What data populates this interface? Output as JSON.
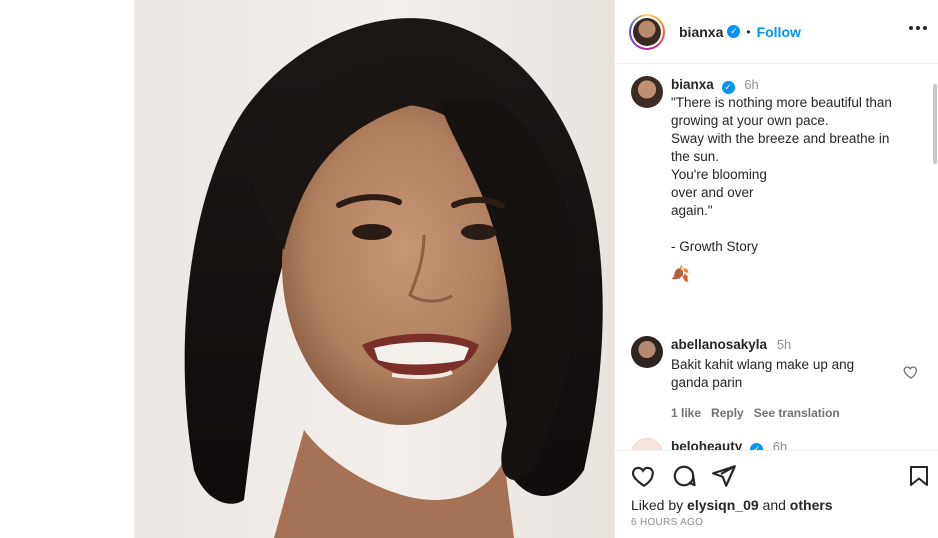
{
  "post": {
    "username": "bianxa",
    "follow_label": "Follow",
    "separator": "•",
    "photo_alt": "Smiling woman with shoulder-length black hair"
  },
  "caption": {
    "username": "bianxa",
    "time": "6h",
    "text": "\"There is nothing more beautiful than growing at your own pace.\nSway with the breeze and breathe in the sun.\nYou're blooming\nover and over\nagain.\"\n\n- Growth Story",
    "emoji": "🍂"
  },
  "comments": [
    {
      "username": "abellanosakyla",
      "time": "5h",
      "text": "Bakit kahit wlang make up ang ganda parin",
      "likes_label": "1 like",
      "reply_label": "Reply",
      "translate_label": "See translation"
    },
    {
      "username": "beloheauty",
      "time": "6h"
    }
  ],
  "footer": {
    "liked_prefix": "Liked by",
    "liked_user": "elysiqn_09",
    "and_label": "and",
    "others_label": "others",
    "timestamp": "6 HOURS AGO"
  },
  "icons": {
    "verified": "verified-badge-icon",
    "more": "more-options-icon",
    "like": "heart-icon",
    "comment": "comment-icon",
    "share": "share-icon",
    "save": "bookmark-icon"
  },
  "colors": {
    "accent": "#0095f6",
    "text": "#262626",
    "muted": "#8e8e8e"
  }
}
